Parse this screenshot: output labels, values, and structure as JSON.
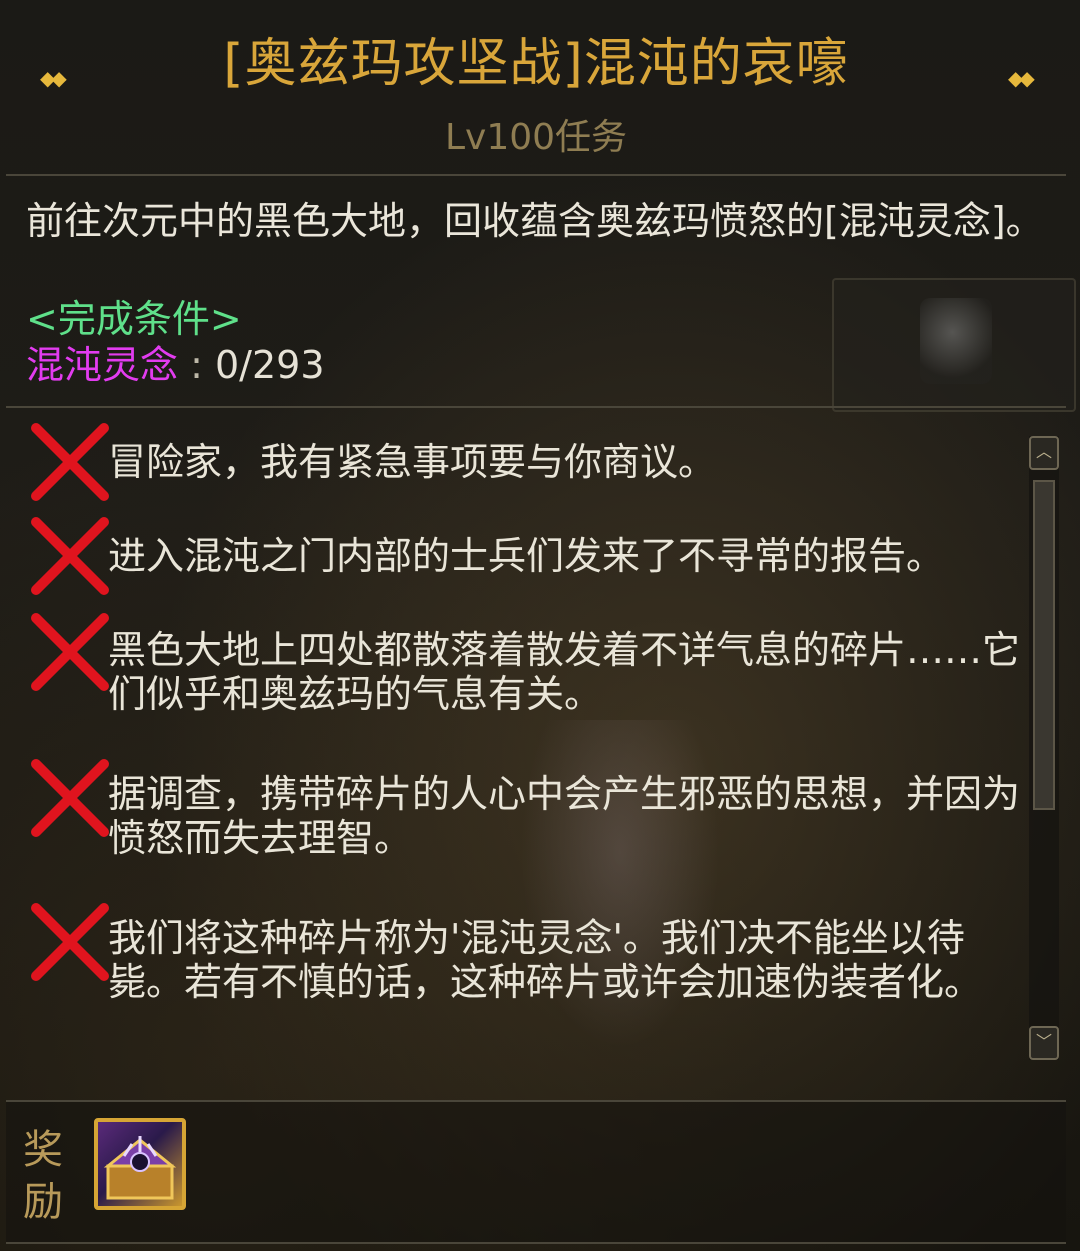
{
  "quest": {
    "title": "[奥兹玛攻坚战]混沌的哀嚎",
    "subtitle": "Lv100任务",
    "description": "前往次元中的黑色大地，回收蕴含奥兹玛愤怒的[混沌灵念]。",
    "condition_heading": "<完成条件>",
    "condition_item": "混沌灵念",
    "condition_separator": " : ",
    "condition_progress": "0/293"
  },
  "dialogues": [
    {
      "text": "冒险家，我有紧急事项要与你商议。",
      "icon": "red-x-icon"
    },
    {
      "text": "进入混沌之门内部的士兵们发来了不寻常的报告。",
      "icon": "red-x-icon"
    },
    {
      "text": "黑色大地上四处都散落着散发着不详气息的碎片……它们似乎和奥兹玛的气息有关。",
      "icon": "red-x-icon"
    },
    {
      "text": "据调查，携带碎片的人心中会产生邪恶的思想，并因为愤怒而失去理智。",
      "icon": "red-x-icon"
    },
    {
      "text": "我们将这种碎片称为'混沌灵念'。我们决不能坐以待毙。若有不慎的话，这种碎片或许会加速伪装者化。",
      "icon": "red-x-icon"
    }
  ],
  "reward": {
    "label": "奖励",
    "icon": "treasure-box-icon"
  },
  "colors": {
    "title": "#d9a63a",
    "condition_heading": "#5fe08a",
    "condition_item": "#e23cf0",
    "x_mark": "#e0141e"
  }
}
